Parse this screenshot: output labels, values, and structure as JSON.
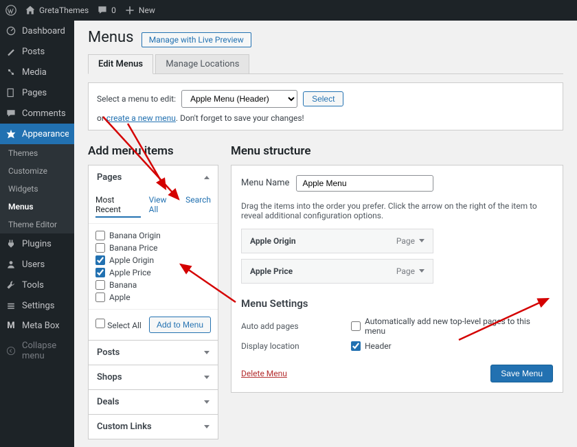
{
  "adminbar": {
    "site_name": "GretaThemes",
    "comments": "0",
    "new": "New"
  },
  "sidebar": {
    "dashboard": "Dashboard",
    "posts": "Posts",
    "media": "Media",
    "pages": "Pages",
    "comments": "Comments",
    "appearance": "Appearance",
    "appearance_sub": {
      "themes": "Themes",
      "customize": "Customize",
      "widgets": "Widgets",
      "menus": "Menus",
      "theme_editor": "Theme Editor"
    },
    "plugins": "Plugins",
    "users": "Users",
    "tools": "Tools",
    "settings": "Settings",
    "meta_box": "Meta Box",
    "collapse": "Collapse menu"
  },
  "page": {
    "title": "Menus",
    "live_preview": "Manage with Live Preview",
    "tabs": {
      "edit": "Edit Menus",
      "locations": "Manage Locations"
    },
    "select_bar": {
      "label": "Select a menu to edit:",
      "selected": "Apple Menu (Header)",
      "select_btn": "Select",
      "or": "or",
      "create_link": "create a new menu",
      "hint": ". Don't forget to save your changes!"
    }
  },
  "add_section": {
    "title": "Add menu items",
    "pages_header": "Pages",
    "page_tabs": {
      "recent": "Most Recent",
      "view_all": "View All",
      "search": "Search"
    },
    "items": {
      "0": "Banana Origin",
      "1": "Banana Price",
      "2": "Apple Origin",
      "3": "Apple Price",
      "4": "Banana",
      "5": "Apple"
    },
    "select_all": "Select All",
    "add_btn": "Add to Menu",
    "accordions": {
      "posts": "Posts",
      "shops": "Shops",
      "deals": "Deals",
      "custom_links": "Custom Links"
    }
  },
  "structure": {
    "title": "Menu structure",
    "name_label": "Menu Name",
    "name_value": "Apple Menu",
    "helper": "Drag the items into the order you prefer. Click the arrow on the right of the item to reveal additional configuration options.",
    "items": {
      "0": {
        "label": "Apple Origin",
        "type": "Page"
      },
      "1": {
        "label": "Apple Price",
        "type": "Page"
      }
    },
    "settings_heading": "Menu Settings",
    "auto_add_label": "Auto add pages",
    "auto_add_cb": "Automatically add new top-level pages to this menu",
    "display_label": "Display location",
    "display_cb": "Header",
    "delete": "Delete Menu",
    "save": "Save Menu"
  }
}
